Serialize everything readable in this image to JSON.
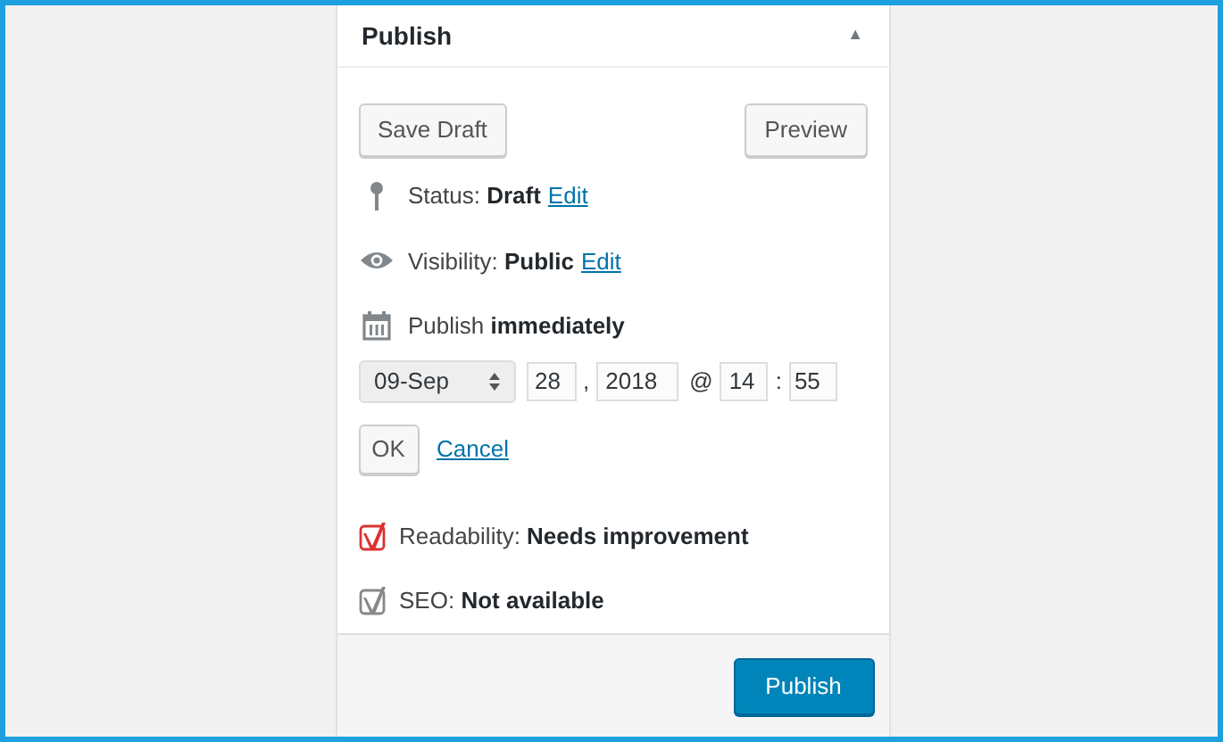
{
  "panel": {
    "title": "Publish",
    "toggle": "▲",
    "expanded": true
  },
  "buttons": {
    "save_draft": "Save Draft",
    "preview": "Preview"
  },
  "misc": [
    {
      "kind": "status",
      "label": "Status:",
      "value": "Draft",
      "link": "Edit"
    },
    {
      "kind": "visibility",
      "label": "Visibility:",
      "value": "Public",
      "link": "Edit"
    },
    {
      "kind": "schedule",
      "label": "Publish",
      "value": "immediately"
    }
  ],
  "date_editor": {
    "month": "09-Sep",
    "day": "28",
    "comma": ",",
    "year": "2018",
    "at": "@",
    "hour": "14",
    "colon": ":",
    "minute": "55",
    "ok": "OK",
    "cancel": "Cancel"
  },
  "seo": [
    {
      "label": "Readability:",
      "value": "Needs improvement",
      "color": "#dc3232"
    },
    {
      "label": "SEO:",
      "value": "Not available",
      "color": "#888888"
    }
  ],
  "footer": {
    "publish": "Publish"
  }
}
